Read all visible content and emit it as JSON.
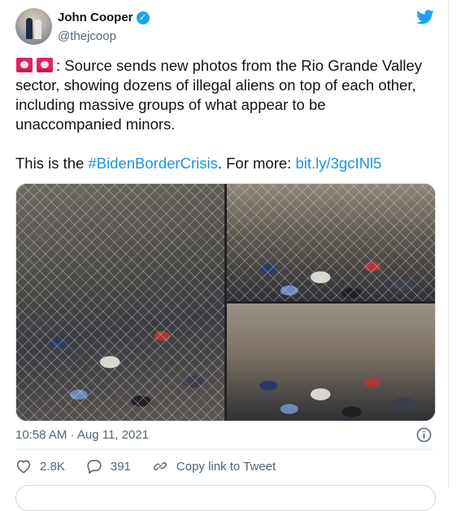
{
  "author": {
    "display_name": "John Cooper",
    "handle": "@thejcoop",
    "verified_icon": "verified-badge-icon"
  },
  "tweet": {
    "text_line1_rest": ": Source sends new photos from the Rio Grande Valley sector, showing dozens of illegal aliens on top of each other, including massive groups of what appear to be unaccompanied minors.",
    "text2_prefix": "This is the ",
    "hashtag": "#BidenBorderCrisis",
    "text2_mid": ". For more: ",
    "link": "bit.ly/3gcINl5",
    "emoji": [
      "police-siren-icon",
      "police-siren-icon"
    ]
  },
  "meta": {
    "timestamp": "10:58 AM · Aug 11, 2021"
  },
  "actions": {
    "likes": "2.8K",
    "replies": "391",
    "copy_link_label": "Copy link to Tweet"
  },
  "colors": {
    "brand": "#1da1f2",
    "link": "#1b95e0",
    "text": "#0f1419",
    "muted": "#536471"
  }
}
